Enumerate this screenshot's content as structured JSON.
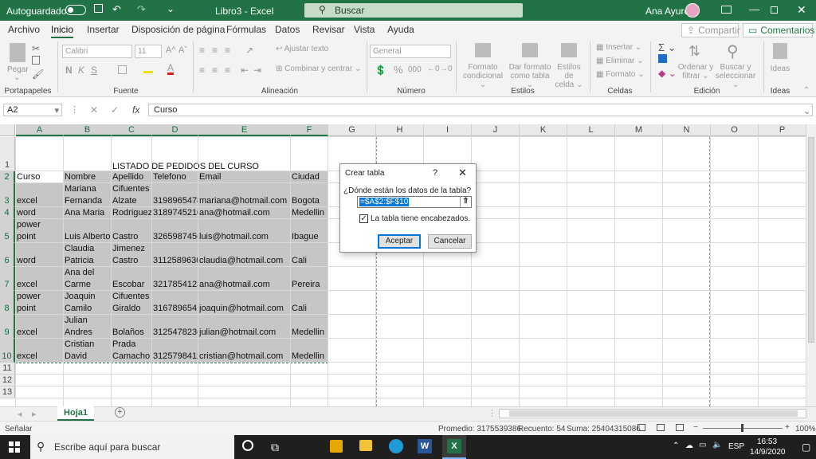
{
  "titlebar": {
    "autosave": "Autoguardado",
    "doc_title": "Libro3  -  Excel",
    "search": "Buscar",
    "user": "Ana Ayure"
  },
  "tabs": [
    "Archivo",
    "Inicio",
    "Insertar",
    "Disposición de página",
    "Fórmulas",
    "Datos",
    "Revisar",
    "Vista",
    "Ayuda"
  ],
  "share": {
    "compartir": "Compartir",
    "comentarios": "Comentarios"
  },
  "ribbon": {
    "pegar": "Pegar",
    "font_name": "Calibri",
    "font_size": "11",
    "bold": "N",
    "italic": "K",
    "underline": "S",
    "wrap": "Ajustar texto",
    "merge": "Combinar y centrar",
    "number_format": "General",
    "percent": "%",
    "thousands": "000",
    "cond_format": [
      "Formato",
      "condicional"
    ],
    "table_format": [
      "Dar formato",
      "como tabla"
    ],
    "cell_styles": [
      "Estilos de",
      "celda"
    ],
    "insert": "Insertar",
    "delete": "Eliminar",
    "format": "Formato",
    "sort": [
      "Ordenar y",
      "filtrar"
    ],
    "find": [
      "Buscar y",
      "seleccionar"
    ],
    "ideas": "Ideas",
    "groups": {
      "clipboard": "Portapapeles",
      "font": "Fuente",
      "align": "Alineación",
      "number": "Número",
      "styles": "Estilos",
      "cells": "Celdas",
      "edit": "Edición",
      "ideas": "Ideas"
    }
  },
  "formula": {
    "namebox": "A2",
    "fx": "fx",
    "value": "Curso"
  },
  "columns": [
    "A",
    "B",
    "C",
    "D",
    "E",
    "F",
    "G",
    "H",
    "I",
    "J",
    "K",
    "L",
    "M",
    "N",
    "O",
    "P"
  ],
  "rows": [
    "1",
    "2",
    "3",
    "4",
    "5",
    "6",
    "7",
    "8",
    "9",
    "10",
    "11",
    "12",
    "13"
  ],
  "sheet": {
    "title": "LISTADO DE PEDIDOS DEL CURSO",
    "headers": [
      "Curso",
      "Nombre",
      "Apellido",
      "Telefono",
      "Email",
      "Ciudad"
    ],
    "data": [
      {
        "curso": [
          "excel"
        ],
        "nombre": [
          "Mariana",
          "Fernanda"
        ],
        "apellido": [
          "Cifuentes",
          "Alzate"
        ],
        "tel": "3198965478",
        "email": "mariana@hotmail.com",
        "ciudad": "Bogota"
      },
      {
        "curso": [
          "word"
        ],
        "nombre": [
          "Ana Maria"
        ],
        "apellido": [
          "Rodriguez"
        ],
        "tel": "3189745210",
        "email": "ana@hotmail.com",
        "ciudad": "Medellin"
      },
      {
        "curso": [
          "power",
          "point"
        ],
        "nombre": [
          "Luis Alberto"
        ],
        "apellido": [
          "Castro"
        ],
        "tel": "3265987456",
        "email": "luis@hotmail.com",
        "ciudad": "Ibague"
      },
      {
        "curso": [
          "word"
        ],
        "nombre": [
          "Claudia",
          "Patricia"
        ],
        "apellido": [
          "Jimenez",
          "Castro"
        ],
        "tel": "3112589630",
        "email": "claudia@hotmail.com",
        "ciudad": "Cali"
      },
      {
        "curso": [
          "excel"
        ],
        "nombre": [
          "Ana del",
          "Carme"
        ],
        "apellido": [
          "Escobar"
        ],
        "tel": "3217854123",
        "email": "ana@hotmail.com",
        "ciudad": "Pereira"
      },
      {
        "curso": [
          "power",
          "point"
        ],
        "nombre": [
          "Joaquin",
          "Camilo"
        ],
        "apellido": [
          "Cifuentes",
          "Giraldo"
        ],
        "tel": "3167896541",
        "email": "joaquin@hotmail.com",
        "ciudad": "Cali"
      },
      {
        "curso": [
          "excel"
        ],
        "nombre": [
          "Julian",
          "Andres"
        ],
        "apellido": [
          "Bolaños"
        ],
        "tel": "3125478236",
        "email": "julian@hotmail.com",
        "ciudad": "Medellin"
      },
      {
        "curso": [
          "excel"
        ],
        "nombre": [
          "Cristian",
          "David"
        ],
        "apellido": [
          "Prada",
          "Camacho"
        ],
        "tel": "3125798412",
        "email": "cristian@hotmail.com",
        "ciudad": "Medellin"
      }
    ]
  },
  "dialog": {
    "title": "Crear tabla",
    "help": "?",
    "question": "¿Dónde están los datos de la tabla?",
    "range": "=$A$2:$F$10",
    "checkbox_label": "La tabla tiene encabezados.",
    "checked": true,
    "ok": "Aceptar",
    "cancel": "Cancelar"
  },
  "sheettabs": {
    "active": "Hoja1",
    "add": "+"
  },
  "status": {
    "mode": "Señalar",
    "promedio": "Promedio: 3175539386",
    "recuento": "Recuento: 54",
    "suma": "Suma: 25404315086",
    "zoom": "100%"
  },
  "taskbar": {
    "search": "Escribe aquí para buscar",
    "lang": "ESP",
    "time": "16:53",
    "date": "14/9/2020"
  },
  "colors": {
    "excel_green": "#217346",
    "selection": "#c6c6c6"
  }
}
